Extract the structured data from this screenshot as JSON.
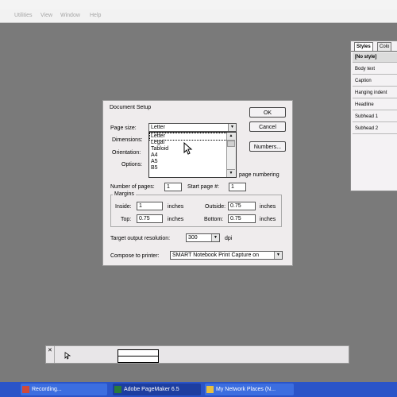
{
  "menu": [
    "Utilities",
    "View",
    "Window",
    "Help"
  ],
  "styles_palette": {
    "tabs": [
      "Styles",
      "Colo"
    ],
    "items": [
      "[No style]",
      "Body text",
      "Caption",
      "Hanging indent",
      "Headline",
      "Subhead 1",
      "Subhead 2"
    ]
  },
  "dialog": {
    "title": "Document Setup",
    "ok_label": "OK",
    "cancel_label": "Cancel",
    "numbers_label": "Numbers...",
    "page_size_label": "Page size:",
    "page_size_value": "Letter",
    "dimensions_label": "Dimensions:",
    "orientation_label": "Orientation:",
    "options_label": "Options:",
    "page_numbering_label": "page numbering",
    "page_size_options": [
      "Letter",
      "Legal",
      "Tabloid",
      "A4",
      "A5",
      "B5"
    ],
    "number_of_pages_label": "Number of pages:",
    "number_of_pages_value": "1",
    "start_page_label": "Start page #:",
    "start_page_value": "1",
    "margins_label": "Margins",
    "inside_label": "Inside:",
    "inside_value": "1",
    "outside_label": "Outside:",
    "outside_value": "0.75",
    "top_label": "Top:",
    "top_value": "0.75",
    "bottom_label": "Bottom:",
    "bottom_value": "0.75",
    "unit": "inches",
    "target_resolution_label": "Target output resolution:",
    "target_resolution_value": "300",
    "dpi_label": "dpi",
    "compose_label": "Compose to printer:",
    "compose_value": "SMART Notebook Print Capture on"
  },
  "taskbar": {
    "items": [
      "Recording...",
      "Adobe PageMaker 6.5",
      "My Network Places (N..."
    ]
  },
  "colors": {
    "workspace": "#7a7a7a",
    "taskbar": "#2a54c8",
    "dialog": "#efeced"
  }
}
